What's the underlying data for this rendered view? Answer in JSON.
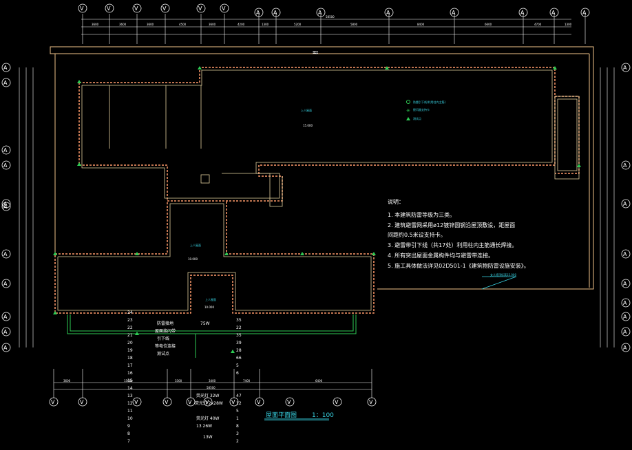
{
  "colors": {
    "background": "#000000",
    "roof_outline": "#f2c38a",
    "parapet": "#e6d3a0",
    "lightning_strip": "#ff9a6a",
    "green_line": "#2ecc55",
    "cyan": "#39d6e6",
    "white": "#ffffff"
  },
  "notes": {
    "heading": "说明：",
    "items": [
      "1. 本建筑防雷等级为三类。",
      "2. 建筑避雷网采用ø12镀锌圆钢沿屋顶敷设，距屋面",
      "    间距约0.5米设支持卡。",
      "3. 避雷带引下线（共17处）利用柱内主筋通长焊接。",
      "4. 所有突出屋面金属构件均与避雷带连接。",
      "5. 施工具体做法详见02D501-1《建筑物防雷设施安装》。"
    ]
  },
  "legend": [
    {
      "symbol": "circle",
      "text": "防雷引下线(利用柱内主筋)"
    },
    {
      "symbol": "star",
      "text": "接闪器支持卡"
    },
    {
      "symbol": "triangle",
      "text": "测试点"
    }
  ],
  "title": {
    "name": "屋面平面图",
    "scale": "1：100"
  },
  "room_labels": [
    "上人屋面",
    "上人屋面",
    "上人屋面"
  ],
  "elevation_labels": [
    "15.000",
    "10.000",
    "10.000"
  ],
  "top_axes": [
    "V",
    "V",
    "V",
    "V",
    "V",
    "V",
    "A",
    "A",
    "A",
    "A",
    "A",
    "A",
    "A",
    "A"
  ],
  "left_axes": [
    "A",
    "A",
    "A",
    "A",
    "A",
    "A",
    "A",
    "A",
    "A",
    "A",
    "A"
  ],
  "right_axes": [
    "A",
    "A",
    "A",
    "A",
    "A",
    "A",
    "A",
    "A",
    "A"
  ],
  "bottom_axes": [
    "V",
    "V",
    "V",
    "V",
    "V",
    "V",
    "V",
    "V",
    "V",
    "V",
    "V"
  ],
  "top_dimensions": [
    "3600",
    "3600",
    "3600",
    "4500",
    "3600",
    "4200",
    "1300",
    "5200",
    "5800",
    "8400",
    "6600",
    "4700",
    "1300"
  ],
  "total_top_dimension": "58500",
  "bottom_dimensions": [
    "3600",
    "15600",
    "3300",
    "3400",
    "7400",
    "6400"
  ],
  "total_bottom_dimension": "58500",
  "table": {
    "left_numbers": [
      "24",
      "23",
      "22",
      "21",
      "20",
      "19",
      "18",
      "17",
      "16",
      "15",
      "14",
      "13",
      "12",
      "11",
      "10",
      "9",
      "8",
      "7",
      "6",
      "5",
      "4",
      "3",
      "2",
      "1"
    ],
    "right_numbers": [
      "35",
      "22",
      "35",
      "39",
      "28",
      "66",
      "5",
      "6",
      "1",
      "1",
      "1",
      "7",
      "1",
      "47",
      "12",
      "5",
      "1",
      "8",
      "3",
      "2",
      "12",
      "2"
    ],
    "labels": [
      "防雷接地",
      "屋面接闪带",
      "引下线",
      "等电位连接",
      "测试点"
    ],
    "fixtures": [
      "75W",
      "荧光灯 32W",
      "荧光灯 2x28W",
      "荧光灯 40W",
      "13W",
      "13 26W"
    ]
  },
  "annotation_right": "女儿墙顶标高15.000",
  "break_mark": "≈"
}
